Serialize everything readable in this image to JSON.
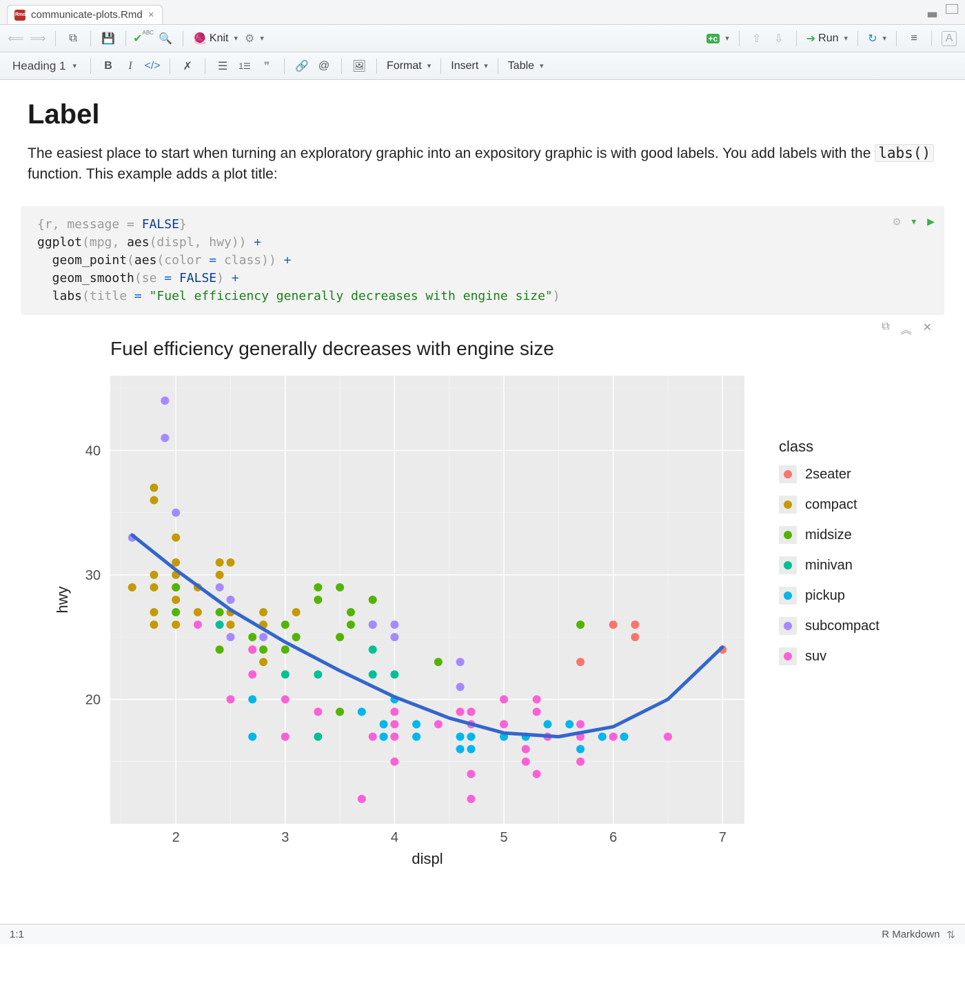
{
  "tab": {
    "filename": "communicate-plots.Rmd"
  },
  "toolbar1": {
    "knit_label": "Knit",
    "run_label": "Run"
  },
  "toolbar2": {
    "style_label": "Heading 1",
    "format_label": "Format",
    "insert_label": "Insert",
    "table_label": "Table"
  },
  "doc": {
    "h1": "Label",
    "para_a": "The easiest place to start when turning an exploratory graphic into an expository graphic is with good labels. You add labels with the ",
    "code": "labs()",
    "para_b": " function. This example adds a plot title:"
  },
  "code": {
    "l1_a": "{r, message = ",
    "l1_b": "FALSE",
    "l1_c": "}",
    "l2_a": "ggplot",
    "l2_b": "(mpg, ",
    "l2_c": "aes",
    "l2_d": "(displ, hwy)) ",
    "l2_e": "+",
    "l3_a": "  geom_point",
    "l3_b": "(",
    "l3_c": "aes",
    "l3_d": "(color ",
    "l3_e": "=",
    "l3_f": " class)) ",
    "l3_g": "+",
    "l4_a": "  geom_smooth",
    "l4_b": "(se ",
    "l4_c": "=",
    "l4_d": " ",
    "l4_e": "FALSE",
    "l4_f": ") ",
    "l4_g": "+",
    "l5_a": "  labs",
    "l5_b": "(title ",
    "l5_c": "=",
    "l5_d": " ",
    "l5_e": "\"Fuel efficiency generally decreases with engine size\"",
    "l5_f": ")"
  },
  "status": {
    "pos": "1:1",
    "type": "R Markdown"
  },
  "chart_data": {
    "type": "scatter",
    "title": "Fuel efficiency generally decreases with engine size",
    "xlabel": "displ",
    "ylabel": "hwy",
    "xlim": [
      1.4,
      7.2
    ],
    "ylim": [
      10,
      46
    ],
    "x_ticks": [
      2,
      3,
      4,
      5,
      6,
      7
    ],
    "y_ticks": [
      20,
      30,
      40
    ],
    "legend_title": "class",
    "classes": [
      "2seater",
      "compact",
      "midsize",
      "minivan",
      "pickup",
      "subcompact",
      "suv"
    ],
    "colors": {
      "2seater": "#F8766D",
      "compact": "#C49A00",
      "midsize": "#53B400",
      "minivan": "#00C094",
      "pickup": "#00B6EB",
      "subcompact": "#A58AFF",
      "suv": "#FB61D7"
    },
    "smooth_line": [
      {
        "x": 1.6,
        "y": 33.2
      },
      {
        "x": 2.0,
        "y": 30.4
      },
      {
        "x": 2.5,
        "y": 27.2
      },
      {
        "x": 3.0,
        "y": 24.6
      },
      {
        "x": 3.5,
        "y": 22.3
      },
      {
        "x": 4.0,
        "y": 20.2
      },
      {
        "x": 4.5,
        "y": 18.5
      },
      {
        "x": 5.0,
        "y": 17.3
      },
      {
        "x": 5.5,
        "y": 17.0
      },
      {
        "x": 6.0,
        "y": 17.8
      },
      {
        "x": 6.5,
        "y": 20.0
      },
      {
        "x": 7.0,
        "y": 24.2
      }
    ],
    "points": [
      {
        "x": 1.6,
        "y": 33,
        "c": "subcompact"
      },
      {
        "x": 1.6,
        "y": 29,
        "c": "compact"
      },
      {
        "x": 1.8,
        "y": 29,
        "c": "compact"
      },
      {
        "x": 1.8,
        "y": 30,
        "c": "compact"
      },
      {
        "x": 1.8,
        "y": 36,
        "c": "compact"
      },
      {
        "x": 1.8,
        "y": 26,
        "c": "compact"
      },
      {
        "x": 1.8,
        "y": 27,
        "c": "compact"
      },
      {
        "x": 1.8,
        "y": 37,
        "c": "compact"
      },
      {
        "x": 1.9,
        "y": 44,
        "c": "subcompact"
      },
      {
        "x": 1.9,
        "y": 41,
        "c": "subcompact"
      },
      {
        "x": 2.0,
        "y": 28,
        "c": "compact"
      },
      {
        "x": 2.0,
        "y": 29,
        "c": "compact"
      },
      {
        "x": 2.0,
        "y": 31,
        "c": "compact"
      },
      {
        "x": 2.0,
        "y": 30,
        "c": "compact"
      },
      {
        "x": 2.0,
        "y": 26,
        "c": "compact"
      },
      {
        "x": 2.0,
        "y": 35,
        "c": "subcompact"
      },
      {
        "x": 2.0,
        "y": 33,
        "c": "compact"
      },
      {
        "x": 2.0,
        "y": 29,
        "c": "midsize"
      },
      {
        "x": 2.0,
        "y": 27,
        "c": "midsize"
      },
      {
        "x": 2.2,
        "y": 27,
        "c": "compact"
      },
      {
        "x": 2.2,
        "y": 29,
        "c": "compact"
      },
      {
        "x": 2.2,
        "y": 26,
        "c": "suv"
      },
      {
        "x": 2.4,
        "y": 24,
        "c": "midsize"
      },
      {
        "x": 2.4,
        "y": 30,
        "c": "compact"
      },
      {
        "x": 2.4,
        "y": 31,
        "c": "compact"
      },
      {
        "x": 2.4,
        "y": 27,
        "c": "midsize"
      },
      {
        "x": 2.4,
        "y": 29,
        "c": "subcompact"
      },
      {
        "x": 2.4,
        "y": 26,
        "c": "minivan"
      },
      {
        "x": 2.5,
        "y": 26,
        "c": "compact"
      },
      {
        "x": 2.5,
        "y": 28,
        "c": "subcompact"
      },
      {
        "x": 2.5,
        "y": 25,
        "c": "subcompact"
      },
      {
        "x": 2.5,
        "y": 31,
        "c": "compact"
      },
      {
        "x": 2.5,
        "y": 27,
        "c": "compact"
      },
      {
        "x": 2.5,
        "y": 20,
        "c": "suv"
      },
      {
        "x": 2.7,
        "y": 24,
        "c": "compact"
      },
      {
        "x": 2.7,
        "y": 25,
        "c": "midsize"
      },
      {
        "x": 2.7,
        "y": 17,
        "c": "pickup"
      },
      {
        "x": 2.7,
        "y": 20,
        "c": "pickup"
      },
      {
        "x": 2.7,
        "y": 22,
        "c": "suv"
      },
      {
        "x": 2.7,
        "y": 24,
        "c": "suv"
      },
      {
        "x": 2.8,
        "y": 26,
        "c": "compact"
      },
      {
        "x": 2.8,
        "y": 27,
        "c": "compact"
      },
      {
        "x": 2.8,
        "y": 23,
        "c": "compact"
      },
      {
        "x": 2.8,
        "y": 24,
        "c": "midsize"
      },
      {
        "x": 2.8,
        "y": 25,
        "c": "subcompact"
      },
      {
        "x": 3.0,
        "y": 26,
        "c": "midsize"
      },
      {
        "x": 3.0,
        "y": 22,
        "c": "minivan"
      },
      {
        "x": 3.0,
        "y": 24,
        "c": "midsize"
      },
      {
        "x": 3.0,
        "y": 20,
        "c": "suv"
      },
      {
        "x": 3.0,
        "y": 17,
        "c": "suv"
      },
      {
        "x": 3.1,
        "y": 27,
        "c": "compact"
      },
      {
        "x": 3.1,
        "y": 25,
        "c": "midsize"
      },
      {
        "x": 3.3,
        "y": 22,
        "c": "minivan"
      },
      {
        "x": 3.3,
        "y": 19,
        "c": "suv"
      },
      {
        "x": 3.3,
        "y": 17,
        "c": "minivan"
      },
      {
        "x": 3.3,
        "y": 28,
        "c": "midsize"
      },
      {
        "x": 3.3,
        "y": 29,
        "c": "midsize"
      },
      {
        "x": 3.5,
        "y": 29,
        "c": "midsize"
      },
      {
        "x": 3.5,
        "y": 25,
        "c": "midsize"
      },
      {
        "x": 3.5,
        "y": 19,
        "c": "midsize"
      },
      {
        "x": 3.6,
        "y": 26,
        "c": "midsize"
      },
      {
        "x": 3.6,
        "y": 27,
        "c": "midsize"
      },
      {
        "x": 3.7,
        "y": 19,
        "c": "pickup"
      },
      {
        "x": 3.7,
        "y": 12,
        "c": "suv"
      },
      {
        "x": 3.8,
        "y": 26,
        "c": "midsize"
      },
      {
        "x": 3.8,
        "y": 28,
        "c": "midsize"
      },
      {
        "x": 3.8,
        "y": 24,
        "c": "minivan"
      },
      {
        "x": 3.8,
        "y": 22,
        "c": "minivan"
      },
      {
        "x": 3.8,
        "y": 26,
        "c": "subcompact"
      },
      {
        "x": 3.8,
        "y": 17,
        "c": "suv"
      },
      {
        "x": 3.9,
        "y": 18,
        "c": "pickup"
      },
      {
        "x": 3.9,
        "y": 17,
        "c": "pickup"
      },
      {
        "x": 4.0,
        "y": 20,
        "c": "pickup"
      },
      {
        "x": 4.0,
        "y": 19,
        "c": "suv"
      },
      {
        "x": 4.0,
        "y": 22,
        "c": "minivan"
      },
      {
        "x": 4.0,
        "y": 17,
        "c": "suv"
      },
      {
        "x": 4.0,
        "y": 18,
        "c": "suv"
      },
      {
        "x": 4.0,
        "y": 15,
        "c": "suv"
      },
      {
        "x": 4.0,
        "y": 25,
        "c": "subcompact"
      },
      {
        "x": 4.0,
        "y": 26,
        "c": "subcompact"
      },
      {
        "x": 4.2,
        "y": 17,
        "c": "pickup"
      },
      {
        "x": 4.2,
        "y": 18,
        "c": "pickup"
      },
      {
        "x": 4.4,
        "y": 18,
        "c": "suv"
      },
      {
        "x": 4.4,
        "y": 23,
        "c": "midsize"
      },
      {
        "x": 4.6,
        "y": 19,
        "c": "suv"
      },
      {
        "x": 4.6,
        "y": 17,
        "c": "pickup"
      },
      {
        "x": 4.6,
        "y": 16,
        "c": "pickup"
      },
      {
        "x": 4.6,
        "y": 23,
        "c": "subcompact"
      },
      {
        "x": 4.6,
        "y": 21,
        "c": "subcompact"
      },
      {
        "x": 4.7,
        "y": 17,
        "c": "pickup"
      },
      {
        "x": 4.7,
        "y": 12,
        "c": "suv"
      },
      {
        "x": 4.7,
        "y": 19,
        "c": "suv"
      },
      {
        "x": 4.7,
        "y": 18,
        "c": "suv"
      },
      {
        "x": 4.7,
        "y": 14,
        "c": "suv"
      },
      {
        "x": 4.7,
        "y": 16,
        "c": "pickup"
      },
      {
        "x": 5.0,
        "y": 20,
        "c": "suv"
      },
      {
        "x": 5.0,
        "y": 17,
        "c": "pickup"
      },
      {
        "x": 5.0,
        "y": 18,
        "c": "suv"
      },
      {
        "x": 5.2,
        "y": 17,
        "c": "pickup"
      },
      {
        "x": 5.2,
        "y": 16,
        "c": "suv"
      },
      {
        "x": 5.2,
        "y": 15,
        "c": "suv"
      },
      {
        "x": 5.3,
        "y": 20,
        "c": "suv"
      },
      {
        "x": 5.3,
        "y": 19,
        "c": "suv"
      },
      {
        "x": 5.3,
        "y": 14,
        "c": "suv"
      },
      {
        "x": 5.4,
        "y": 17,
        "c": "suv"
      },
      {
        "x": 5.4,
        "y": 18,
        "c": "pickup"
      },
      {
        "x": 5.6,
        "y": 18,
        "c": "pickup"
      },
      {
        "x": 5.7,
        "y": 26,
        "c": "midsize"
      },
      {
        "x": 5.7,
        "y": 23,
        "c": "2seater"
      },
      {
        "x": 5.7,
        "y": 17,
        "c": "suv"
      },
      {
        "x": 5.7,
        "y": 15,
        "c": "suv"
      },
      {
        "x": 5.7,
        "y": 18,
        "c": "suv"
      },
      {
        "x": 5.7,
        "y": 16,
        "c": "pickup"
      },
      {
        "x": 5.9,
        "y": 17,
        "c": "pickup"
      },
      {
        "x": 6.0,
        "y": 17,
        "c": "suv"
      },
      {
        "x": 6.0,
        "y": 26,
        "c": "2seater"
      },
      {
        "x": 6.1,
        "y": 17,
        "c": "pickup"
      },
      {
        "x": 6.2,
        "y": 25,
        "c": "2seater"
      },
      {
        "x": 6.2,
        "y": 26,
        "c": "2seater"
      },
      {
        "x": 6.5,
        "y": 17,
        "c": "suv"
      },
      {
        "x": 7.0,
        "y": 24,
        "c": "2seater"
      }
    ]
  }
}
